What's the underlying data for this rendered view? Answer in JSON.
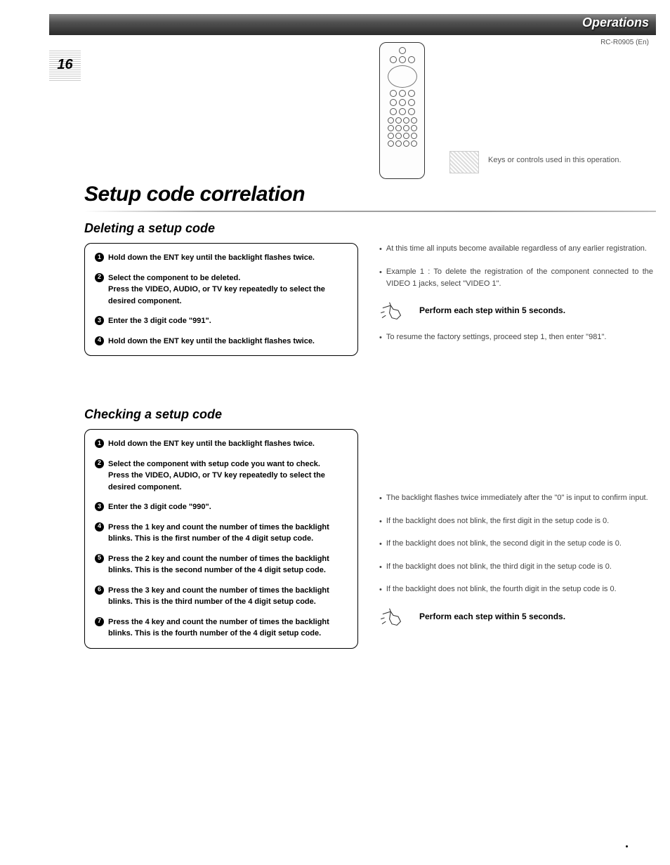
{
  "header": {
    "section_title": "Operations",
    "model_id": "RC-R0905 (En)"
  },
  "page_number": "16",
  "legend": {
    "text": "Keys or controls used in this operation."
  },
  "main_title": "Setup code correlation",
  "deleting": {
    "title": "Deleting a setup code",
    "steps": [
      {
        "n": "1",
        "main": "Hold down the ENT key until the backlight flashes twice."
      },
      {
        "n": "2",
        "main": "Select the component to be deleted.",
        "sub": "Press the VIDEO, AUDIO, or TV key repeatedly to select the desired component."
      },
      {
        "n": "3",
        "main": "Enter the 3 digit code \"991\"."
      },
      {
        "n": "4",
        "main": "Hold down the ENT key until the backlight flashes twice."
      }
    ],
    "notes": [
      "At this time all inputs become available regardless of any earlier registration.",
      "Example 1 : To delete the registration of the component connected to the VIDEO 1 jacks, select \"VIDEO 1\"."
    ],
    "hand_text": "Perform each step within 5 seconds.",
    "resume_note": "To resume the factory settings, proceed step 1, then enter \"981\"."
  },
  "checking": {
    "title": "Checking a setup code",
    "steps": [
      {
        "n": "1",
        "main": "Hold down the ENT key until the backlight flashes twice."
      },
      {
        "n": "2",
        "main": "Select the component with setup code you want to check.",
        "sub": "Press the VIDEO, AUDIO, or TV key repeatedly to select the desired component."
      },
      {
        "n": "3",
        "main": "Enter the 3 digit code \"990\"."
      },
      {
        "n": "4",
        "main": "Press the 1 key and count the number of times the backlight blinks. This is the first number of the 4 digit setup code."
      },
      {
        "n": "5",
        "main": "Press the 2 key and count the number of times the backlight blinks. This is the second number of the 4 digit setup code."
      },
      {
        "n": "6",
        "main": "Press the 3 key and count the number of times the backlight blinks. This is the third number of the 4 digit setup code."
      },
      {
        "n": "7",
        "main": "Press the 4 key and count the number of times the backlight blinks. This is the fourth number of the 4 digit setup code."
      }
    ],
    "notes": [
      "The backlight flashes twice immediately after the \"0\" is input to confirm input.",
      "If the backlight does not blink, the first digit in the setup code is 0.",
      "If the backlight does not blink, the second digit in the setup code is 0.",
      "If the backlight does not blink, the third digit in the setup code is 0.",
      "If the backlight does not blink, the fourth digit in the setup code is 0."
    ],
    "hand_text": "Perform each step within 5 seconds."
  }
}
